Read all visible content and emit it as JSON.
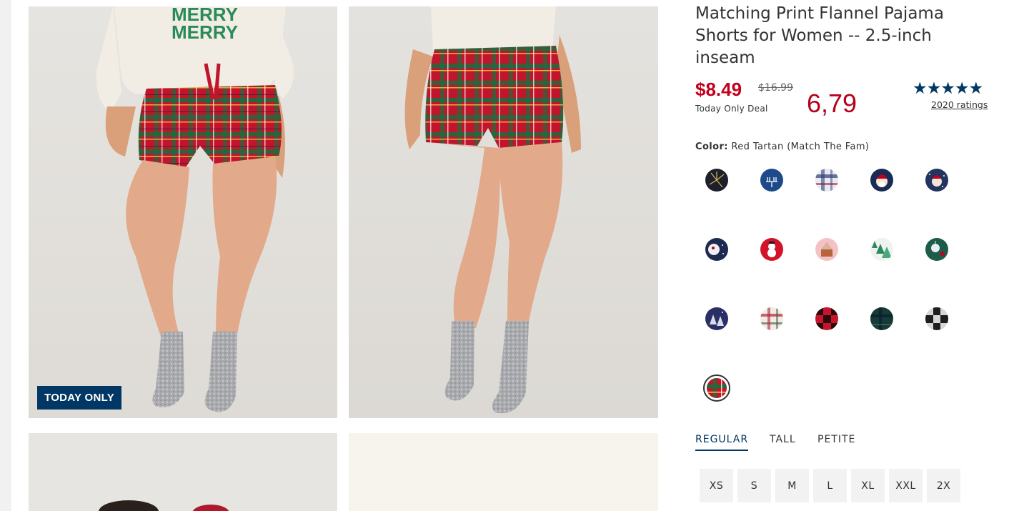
{
  "product": {
    "title": "Matching Print Flannel Pajama Shorts for Women -- 2.5-inch inseam",
    "price": "$8.49",
    "original_price": "$16.99",
    "deal_label": "Today Only Deal",
    "alt_price": "6,79",
    "stars": "★★★★★",
    "ratings_link": "2020 ratings",
    "badge": "TODAY ONLY"
  },
  "color": {
    "label": "Color:",
    "value": "Red Tartan (Match The Fam)",
    "swatches": [
      {
        "name": "fireworks-navy"
      },
      {
        "name": "menorah-blue"
      },
      {
        "name": "plaid-blue-white"
      },
      {
        "name": "santa-navy"
      },
      {
        "name": "santa-snow-navy"
      },
      {
        "name": "santa-moon-navy"
      },
      {
        "name": "snowman-red"
      },
      {
        "name": "gingerbread-pink"
      },
      {
        "name": "trees-white"
      },
      {
        "name": "ornaments-green"
      },
      {
        "name": "trees-navy"
      },
      {
        "name": "plaid-cream"
      },
      {
        "name": "buffalo-red"
      },
      {
        "name": "plaid-green"
      },
      {
        "name": "buffalo-gray"
      },
      {
        "name": "red-tartan"
      }
    ]
  },
  "fit_tabs": [
    "REGULAR",
    "TALL",
    "PETITE"
  ],
  "sizes": [
    "XS",
    "S",
    "M",
    "L",
    "XL",
    "XXL",
    "2X"
  ],
  "colors": {
    "accent": "#003764",
    "price": "#c4001d"
  }
}
